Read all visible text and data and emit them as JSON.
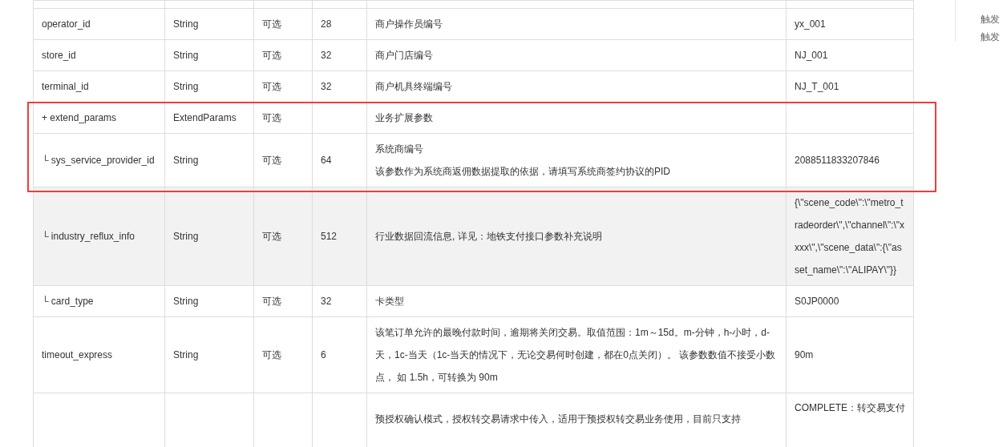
{
  "table": {
    "rows": [
      {
        "name": "operator_id",
        "type": "String",
        "required": "可选",
        "length": "28",
        "description": [
          "商户操作员编号"
        ],
        "example": "yx_001",
        "shaded": false
      },
      {
        "name": "store_id",
        "type": "String",
        "required": "可选",
        "length": "32",
        "description": [
          "商户门店编号"
        ],
        "example": "NJ_001",
        "shaded": false
      },
      {
        "name": "terminal_id",
        "type": "String",
        "required": "可选",
        "length": "32",
        "description": [
          "商户机具终端编号"
        ],
        "example": "NJ_T_001",
        "shaded": false
      },
      {
        "name": "+ extend_params",
        "type": "ExtendParams",
        "required": "可选",
        "description": [
          "业务扩展参数"
        ],
        "shaded": false
      },
      {
        "name": "└ sys_service_provider_id",
        "type": "String",
        "required": "可选",
        "length": "64",
        "description": [
          "系统商编号",
          "该参数作为系统商返佣数据提取的依据，请填写系统商签约协议的PID"
        ],
        "example": "2088511833207846",
        "shaded": false
      },
      {
        "name": "└ industry_reflux_info",
        "type": "String",
        "required": "可选",
        "length": "512",
        "description": [
          "行业数据回流信息, 详见：地铁支付接口参数补充说明"
        ],
        "example": "{\\\"scene_code\\\":\\\"metro_tradeorder\\\",\\\"channel\\\":\\\"xxxx\\\",\\\"scene_data\\\":{\\\"asset_name\\\":\\\"ALIPAY\\\"}}",
        "shaded": true
      },
      {
        "name": "└ card_type",
        "type": "String",
        "required": "可选",
        "length": "32",
        "description": [
          "卡类型"
        ],
        "example": "S0JP0000",
        "shaded": false
      },
      {
        "name": "timeout_express",
        "type": "String",
        "required": "可选",
        "length": "6",
        "description": [
          "该笔订单允许的最晚付款时间，逾期将关闭交易。取值范围：1m～15d。m-分钟，h-小时，d-天，1c-当天（1c-当天的情况下，无论交易何时创建，都在0点关闭）。 该参数数值不接受小数点， 如 1.5h，可转换为 90m"
        ],
        "example": "90m",
        "shaded": false
      },
      {
        "description": [
          "预授权确认模式，授权转交易请求中传入，适用于预授权转交易业务使用，目前只支持"
        ],
        "example": "COMPLETE：转交易支付",
        "shaded": false
      }
    ]
  },
  "side_notes": [
    "触发",
    "触发"
  ]
}
